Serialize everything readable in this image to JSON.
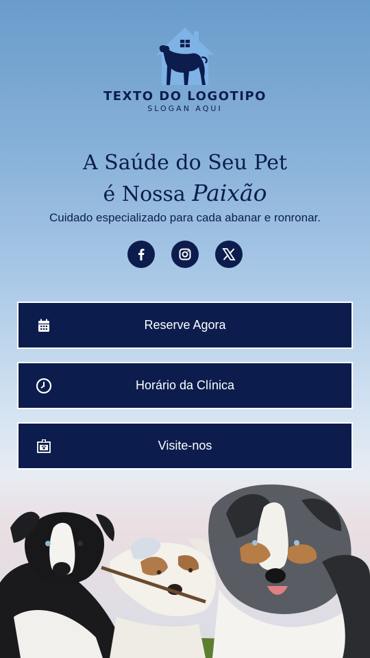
{
  "brand": {
    "logo_text": "TEXTO DO LOGOTIPO",
    "slogan": "SLOGAN AQUI",
    "logo_icon": "dog-house-icon"
  },
  "hero": {
    "headline_line1": "A Saúde do Seu Pet",
    "headline_line2_prefix": "é Nossa",
    "headline_line2_script": "Paixão",
    "subtitle": "Cuidado especializado para cada abanar e ronronar."
  },
  "socials": [
    {
      "name": "facebook",
      "icon": "facebook-icon"
    },
    {
      "name": "instagram",
      "icon": "instagram-icon"
    },
    {
      "name": "x",
      "icon": "x-icon"
    }
  ],
  "buttons": [
    {
      "label": "Reserve Agora",
      "icon": "calendar-icon"
    },
    {
      "label": "Horário da Clínica",
      "icon": "clock-icon"
    },
    {
      "label": "Visite-nos",
      "icon": "clinic-icon"
    }
  ],
  "colors": {
    "navy": "#0c1d4d",
    "sky_top": "#6a9ccb",
    "white": "#ffffff"
  }
}
